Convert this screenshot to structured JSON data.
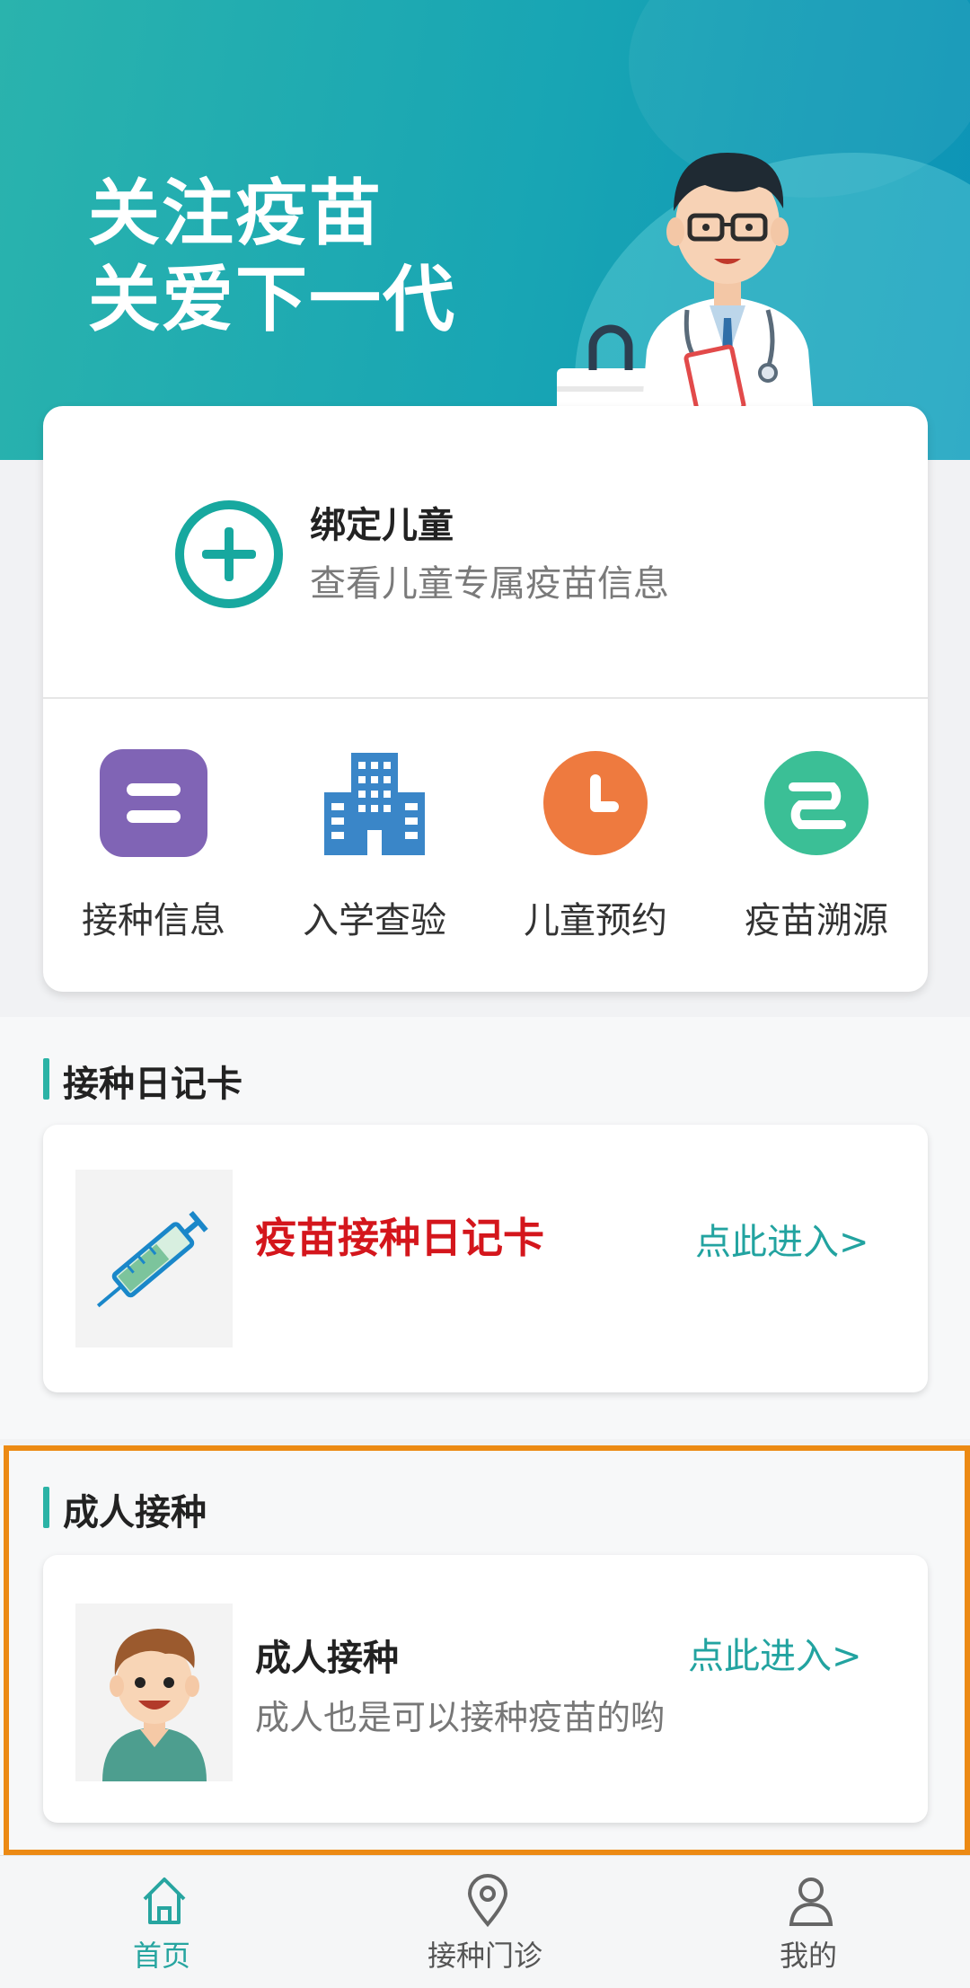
{
  "banner": {
    "slogan_line1": "关注疫苗",
    "slogan_line2": "关爱下一代",
    "gradient_colors": [
      "#2ab3ad",
      "#0c93b7"
    ]
  },
  "bind_child": {
    "title": "绑定儿童",
    "subtitle": "查看儿童专属疫苗信息",
    "icon": "plus-circle-icon",
    "accent": "#17a89f"
  },
  "quick_menu": [
    {
      "label": "接种信息",
      "icon": "vaccination-info-icon",
      "color": "#8064b5"
    },
    {
      "label": "入学查验",
      "icon": "school-building-icon",
      "color": "#3a86c8"
    },
    {
      "label": "儿童预约",
      "icon": "clock-icon",
      "color": "#ee7a3f"
    },
    {
      "label": "疫苗溯源",
      "icon": "trace-icon",
      "color": "#3bbf96"
    }
  ],
  "diary_section": {
    "title": "接种日记卡",
    "card_title": "疫苗接种日记卡",
    "link": "点此进入>",
    "icon": "syringe-icon"
  },
  "adult_section": {
    "title": "成人接种",
    "card_title": "成人接种",
    "card_subtitle": "成人也是可以接种疫苗的哟",
    "link": "点此进入>",
    "icon": "adult-avatar-icon"
  },
  "tabbar": {
    "items": [
      {
        "label": "首页",
        "icon": "home-icon",
        "active": true
      },
      {
        "label": "接种门诊",
        "icon": "location-pin-icon",
        "active": false
      },
      {
        "label": "我的",
        "icon": "user-icon",
        "active": false
      }
    ],
    "active_color": "#27a5a0",
    "inactive_color": "#555555"
  },
  "colors": {
    "section_bar": "#2bb3a6",
    "diary_title": "#d4161c",
    "link": "#22a3a0",
    "highlight_border": "#ec8a14"
  }
}
